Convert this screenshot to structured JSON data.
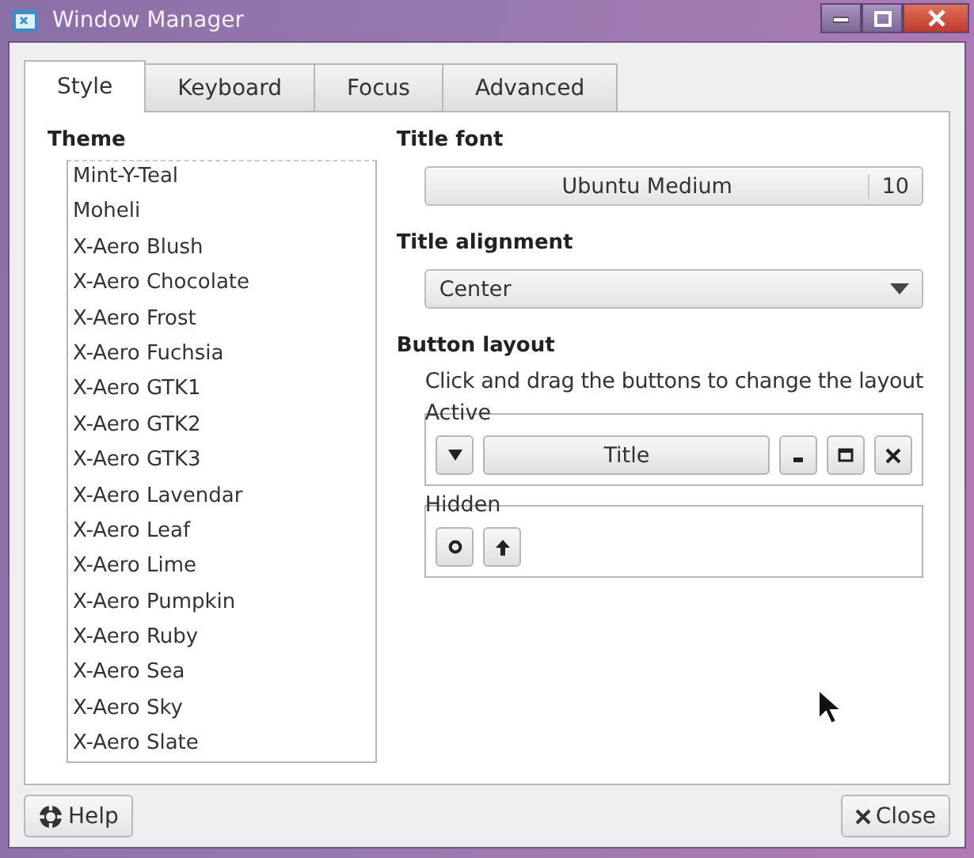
{
  "window": {
    "title": "Window Manager"
  },
  "tabs": [
    {
      "label": "Style",
      "selected": true
    },
    {
      "label": "Keyboard",
      "selected": false
    },
    {
      "label": "Focus",
      "selected": false
    },
    {
      "label": "Advanced",
      "selected": false
    }
  ],
  "theme": {
    "heading": "Theme",
    "items": [
      "Mint-Y-Teal",
      "Moheli",
      "X-Aero Blush",
      "X-Aero Chocolate",
      "X-Aero Frost",
      "X-Aero Fuchsia",
      "X-Aero GTK1",
      "X-Aero GTK2",
      "X-Aero GTK3",
      "X-Aero Lavendar",
      "X-Aero Leaf",
      "X-Aero Lime",
      "X-Aero Pumpkin",
      "X-Aero Ruby",
      "X-Aero Sea",
      "X-Aero Sky",
      "X-Aero Slate"
    ]
  },
  "title_font": {
    "heading": "Title font",
    "font": "Ubuntu Medium",
    "size": "10"
  },
  "title_alignment": {
    "heading": "Title alignment",
    "value": "Center"
  },
  "button_layout": {
    "heading": "Button layout",
    "hint": "Click and drag the buttons to change the layout",
    "active": {
      "label": "Active",
      "buttons": [
        {
          "kind": "menu"
        },
        {
          "kind": "title",
          "label": "Title"
        },
        {
          "kind": "minimize"
        },
        {
          "kind": "maximize"
        },
        {
          "kind": "close"
        }
      ]
    },
    "hidden": {
      "label": "Hidden",
      "buttons": [
        {
          "kind": "stick"
        },
        {
          "kind": "shade"
        }
      ]
    }
  },
  "footer": {
    "help": "Help",
    "close": "Close"
  }
}
